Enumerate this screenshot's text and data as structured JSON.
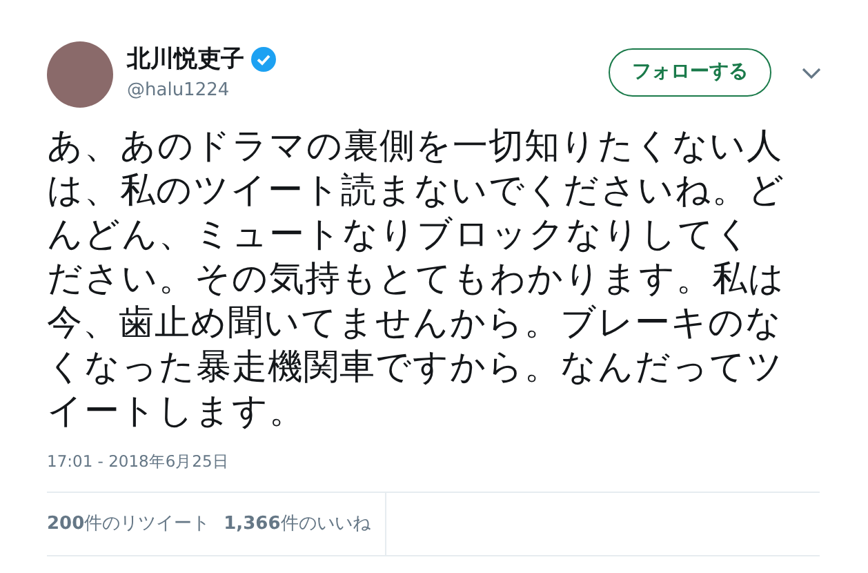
{
  "user": {
    "name": "北川悦吏子",
    "verified": true,
    "handle": "@halu1224"
  },
  "follow_button": "フォローする",
  "tweet_text": "あ、あのドラマの裏側を一切知りたくない人は、私のツイート読まないでくださいね。どんどん、ミュートなりブロックなりしてください。その気持もとてもわかります。私は今、歯止め聞いてませんから。ブレーキのなくなった暴走機関車ですから。なんだってツイートします。",
  "timestamp": "17:01 - 2018年6月25日",
  "stats": [
    "**200**件のリツイート",
    "**1,366**件のいいね"
  ]
}
